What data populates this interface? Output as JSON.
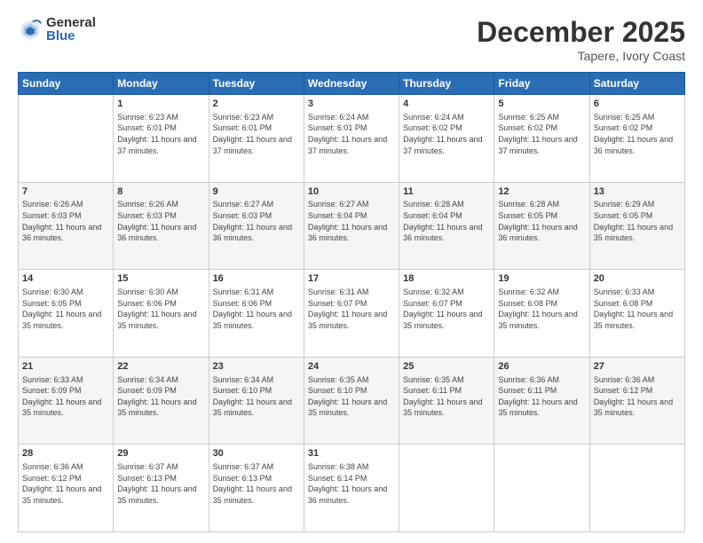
{
  "logo": {
    "general": "General",
    "blue": "Blue"
  },
  "title": "December 2025",
  "location": "Tapere, Ivory Coast",
  "days_of_week": [
    "Sunday",
    "Monday",
    "Tuesday",
    "Wednesday",
    "Thursday",
    "Friday",
    "Saturday"
  ],
  "weeks": [
    [
      {
        "day": "",
        "info": ""
      },
      {
        "day": "1",
        "info": "Sunrise: 6:23 AM\nSunset: 6:01 PM\nDaylight: 11 hours and 37 minutes."
      },
      {
        "day": "2",
        "info": "Sunrise: 6:23 AM\nSunset: 6:01 PM\nDaylight: 11 hours and 37 minutes."
      },
      {
        "day": "3",
        "info": "Sunrise: 6:24 AM\nSunset: 6:01 PM\nDaylight: 11 hours and 37 minutes."
      },
      {
        "day": "4",
        "info": "Sunrise: 6:24 AM\nSunset: 6:02 PM\nDaylight: 11 hours and 37 minutes."
      },
      {
        "day": "5",
        "info": "Sunrise: 6:25 AM\nSunset: 6:02 PM\nDaylight: 11 hours and 37 minutes."
      },
      {
        "day": "6",
        "info": "Sunrise: 6:25 AM\nSunset: 6:02 PM\nDaylight: 11 hours and 36 minutes."
      }
    ],
    [
      {
        "day": "7",
        "info": "Sunrise: 6:26 AM\nSunset: 6:03 PM\nDaylight: 11 hours and 36 minutes."
      },
      {
        "day": "8",
        "info": "Sunrise: 6:26 AM\nSunset: 6:03 PM\nDaylight: 11 hours and 36 minutes."
      },
      {
        "day": "9",
        "info": "Sunrise: 6:27 AM\nSunset: 6:03 PM\nDaylight: 11 hours and 36 minutes."
      },
      {
        "day": "10",
        "info": "Sunrise: 6:27 AM\nSunset: 6:04 PM\nDaylight: 11 hours and 36 minutes."
      },
      {
        "day": "11",
        "info": "Sunrise: 6:28 AM\nSunset: 6:04 PM\nDaylight: 11 hours and 36 minutes."
      },
      {
        "day": "12",
        "info": "Sunrise: 6:28 AM\nSunset: 6:05 PM\nDaylight: 11 hours and 36 minutes."
      },
      {
        "day": "13",
        "info": "Sunrise: 6:29 AM\nSunset: 6:05 PM\nDaylight: 11 hours and 35 minutes."
      }
    ],
    [
      {
        "day": "14",
        "info": "Sunrise: 6:30 AM\nSunset: 6:05 PM\nDaylight: 11 hours and 35 minutes."
      },
      {
        "day": "15",
        "info": "Sunrise: 6:30 AM\nSunset: 6:06 PM\nDaylight: 11 hours and 35 minutes."
      },
      {
        "day": "16",
        "info": "Sunrise: 6:31 AM\nSunset: 6:06 PM\nDaylight: 11 hours and 35 minutes."
      },
      {
        "day": "17",
        "info": "Sunrise: 6:31 AM\nSunset: 6:07 PM\nDaylight: 11 hours and 35 minutes."
      },
      {
        "day": "18",
        "info": "Sunrise: 6:32 AM\nSunset: 6:07 PM\nDaylight: 11 hours and 35 minutes."
      },
      {
        "day": "19",
        "info": "Sunrise: 6:32 AM\nSunset: 6:08 PM\nDaylight: 11 hours and 35 minutes."
      },
      {
        "day": "20",
        "info": "Sunrise: 6:33 AM\nSunset: 6:08 PM\nDaylight: 11 hours and 35 minutes."
      }
    ],
    [
      {
        "day": "21",
        "info": "Sunrise: 6:33 AM\nSunset: 6:09 PM\nDaylight: 11 hours and 35 minutes."
      },
      {
        "day": "22",
        "info": "Sunrise: 6:34 AM\nSunset: 6:09 PM\nDaylight: 11 hours and 35 minutes."
      },
      {
        "day": "23",
        "info": "Sunrise: 6:34 AM\nSunset: 6:10 PM\nDaylight: 11 hours and 35 minutes."
      },
      {
        "day": "24",
        "info": "Sunrise: 6:35 AM\nSunset: 6:10 PM\nDaylight: 11 hours and 35 minutes."
      },
      {
        "day": "25",
        "info": "Sunrise: 6:35 AM\nSunset: 6:11 PM\nDaylight: 11 hours and 35 minutes."
      },
      {
        "day": "26",
        "info": "Sunrise: 6:36 AM\nSunset: 6:11 PM\nDaylight: 11 hours and 35 minutes."
      },
      {
        "day": "27",
        "info": "Sunrise: 6:36 AM\nSunset: 6:12 PM\nDaylight: 11 hours and 35 minutes."
      }
    ],
    [
      {
        "day": "28",
        "info": "Sunrise: 6:36 AM\nSunset: 6:12 PM\nDaylight: 11 hours and 35 minutes."
      },
      {
        "day": "29",
        "info": "Sunrise: 6:37 AM\nSunset: 6:13 PM\nDaylight: 11 hours and 35 minutes."
      },
      {
        "day": "30",
        "info": "Sunrise: 6:37 AM\nSunset: 6:13 PM\nDaylight: 11 hours and 35 minutes."
      },
      {
        "day": "31",
        "info": "Sunrise: 6:38 AM\nSunset: 6:14 PM\nDaylight: 11 hours and 36 minutes."
      },
      {
        "day": "",
        "info": ""
      },
      {
        "day": "",
        "info": ""
      },
      {
        "day": "",
        "info": ""
      }
    ]
  ]
}
